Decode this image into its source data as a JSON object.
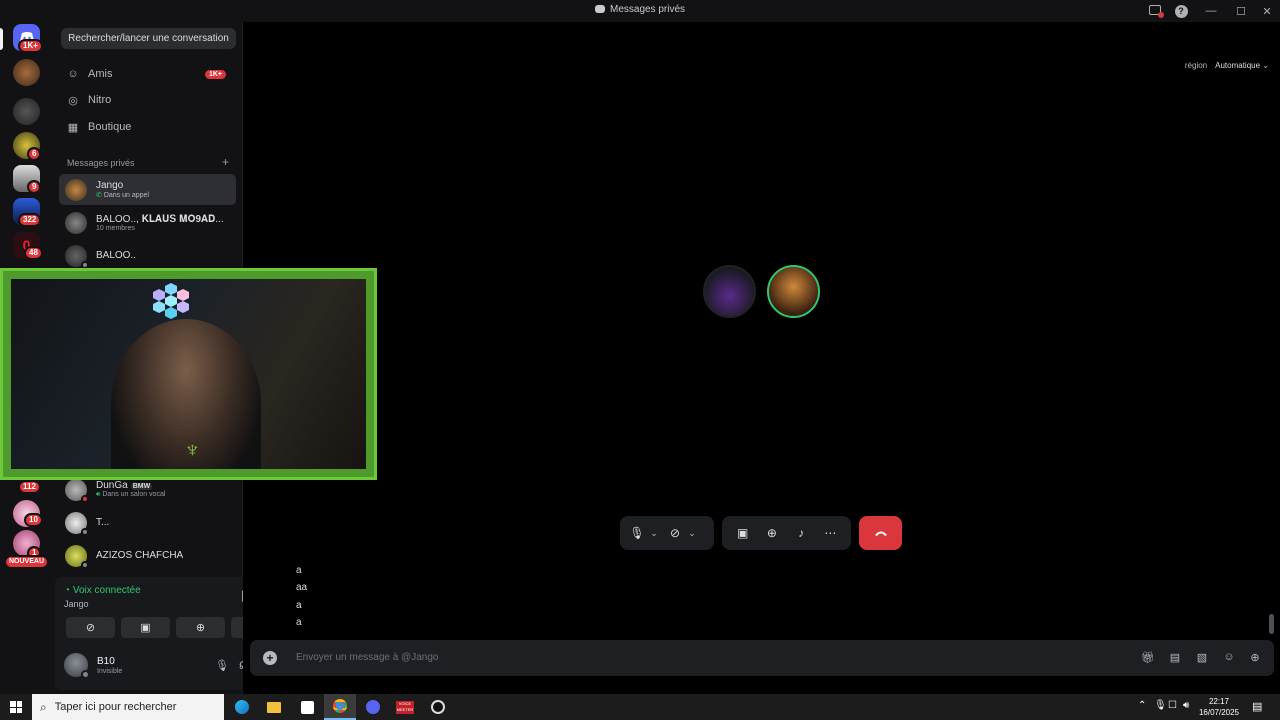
{
  "window": {
    "title": "Messages privés"
  },
  "rail": {
    "badges": [
      "1K+",
      "6",
      "9",
      "322",
      "48",
      "112",
      "10",
      "1"
    ],
    "new_label": "NOUVEAU"
  },
  "sidebar": {
    "search_label": "Rechercher/lancer une conversation",
    "nav": [
      {
        "label": "Amis",
        "icon": "friends-icon",
        "badge": "1K+"
      },
      {
        "label": "Nitro",
        "icon": "nitro-icon"
      },
      {
        "label": "Boutique",
        "icon": "shop-icon"
      }
    ],
    "dm_header": "Messages privés",
    "dm_add": "+",
    "dms": [
      {
        "name": "Jango",
        "sub": "Dans un appel"
      },
      {
        "name": "BALOO.., 𝐊𝐋𝐀𝐔𝐒 𝐌𝐎𝟗𝐀𝐃...",
        "sub": "10 membres"
      },
      {
        "name": "BALOO..",
        "sub": ""
      },
      {
        "name": "DunGa",
        "tag": "BMW",
        "sub": "Dans un salon vocal"
      },
      {
        "name": "T...",
        "sub": ""
      },
      {
        "name": "AZIZOS CHAFCHA",
        "sub": ""
      }
    ]
  },
  "voice": {
    "title": "Voix connectée",
    "channel": "Jango"
  },
  "user": {
    "name": "B10",
    "status": "Invisible"
  },
  "main": {
    "region_label": "région",
    "region_value": "Automatique",
    "messages": [
      "a",
      "aa",
      "a",
      "a"
    ],
    "composer_placeholder": "Envoyer un message à @Jango"
  },
  "taskbar": {
    "search_placeholder": "Taper ici pour rechercher",
    "time": "22:17",
    "date": "16/07/2025",
    "voice_app_label": "VOICE MEETER"
  },
  "colors": {
    "accent_red": "#da373c",
    "connected_green": "#2dc770",
    "cam_frame": "#6cc93a"
  }
}
